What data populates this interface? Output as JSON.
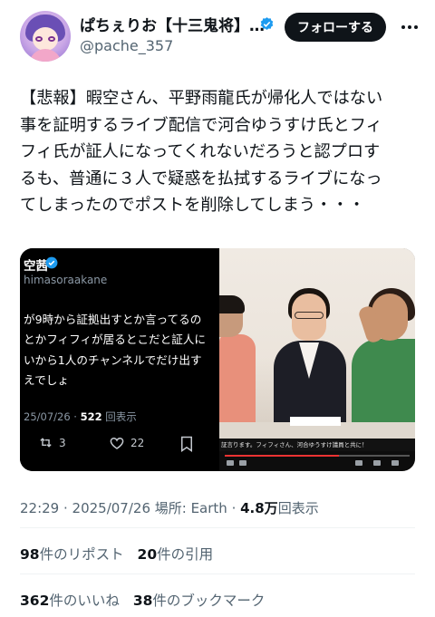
{
  "author": {
    "display_name": "ぱちぇりお【十三鬼将】…",
    "handle": "@pache_357",
    "verified_icon": "verified-badge-icon"
  },
  "follow_button": {
    "label": "フォローする"
  },
  "tweet": {
    "text": "【悲報】暇空さん、平野雨龍氏が帰化人ではない\n事を証明するライブ配信で河合ゆうすけ氏とフィ\nフィ氏が証人になってくれないだろうと認プロす\nるも、普通に３人で疑惑を払拭するライブになっ\nてしまったのでポストを削除してしまう・・・"
  },
  "media": {
    "left": {
      "name": "空茜",
      "handle": "himasoraakane",
      "body": "が9時から証拠出すとか言ってるの\nとかフィフィが居るとこだと証人に\nいから1人のチャンネルでだけ出す\nえでしょ",
      "date": "25/07/26 · ",
      "views": "522",
      "views_label": " 回表示",
      "retweets": "3",
      "likes": "22"
    },
    "right": {
      "caption": "証言ります。フィフィさん、河合ゆうすけ議員と共に！"
    }
  },
  "meta": {
    "time": "22:29 · 2025/07/26 場所: Earth · ",
    "views": "4.8万",
    "views_label": "回表示"
  },
  "stats": {
    "reposts_num": "98",
    "reposts_label": "件のリポスト",
    "quotes_num": "20",
    "quotes_label": "件の引用",
    "likes_num": "362",
    "likes_label": "件のいいね",
    "bookmarks_num": "38",
    "bookmarks_label": "件のブックマーク"
  },
  "colors": {
    "text": "#0f1419",
    "secondary": "#536471",
    "verified": "#1d9bf0",
    "button_bg": "#0f1419"
  }
}
